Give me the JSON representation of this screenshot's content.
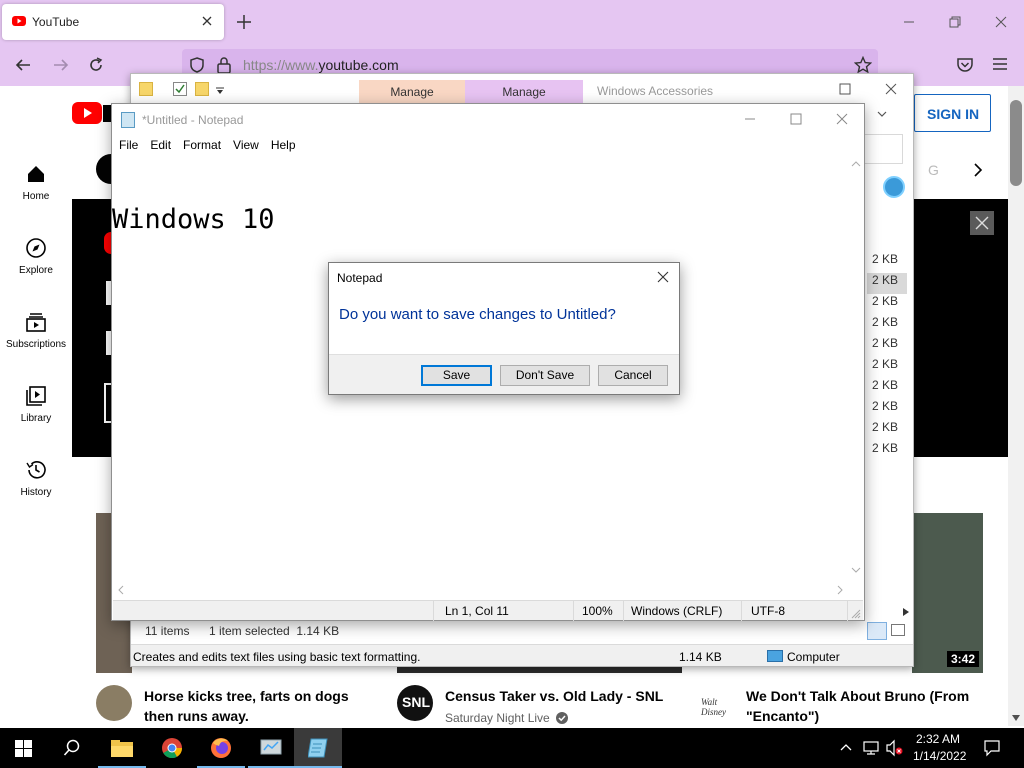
{
  "browser": {
    "tab_title": "YouTube",
    "url_dim": "https://www.",
    "url_host": "youtube.com",
    "accent": "#e5c6f2"
  },
  "youtube": {
    "sign_in": "SIGN IN",
    "nav": [
      {
        "label": "Home",
        "icon": "home-icon"
      },
      {
        "label": "Explore",
        "icon": "compass-icon"
      },
      {
        "label": "Subscriptions",
        "icon": "subscriptions-icon"
      },
      {
        "label": "Library",
        "icon": "library-icon"
      },
      {
        "label": "History",
        "icon": "history-icon"
      }
    ],
    "chip_next_letter": "G",
    "duration": "3:42",
    "videos": [
      {
        "title": "Horse kicks tree, farts on dogs then runs away.",
        "channel": ""
      },
      {
        "title": "Census Taker vs. Old Lady - SNL",
        "channel": "Saturday Night Live"
      },
      {
        "title": "We Don't Talk About Bruno (From \"Encanto\")",
        "channel": ""
      }
    ]
  },
  "explorer": {
    "tabs": [
      "Manage",
      "Manage"
    ],
    "title": "Windows Accessories",
    "sizes": [
      "2 KB",
      "2 KB",
      "2 KB",
      "2 KB",
      "2 KB",
      "2 KB",
      "2 KB",
      "2 KB",
      "2 KB",
      "2 KB"
    ],
    "items_count": "11 items",
    "selected": "1 item selected  1.14 KB",
    "status_desc": "Creates and edits text files using basic text formatting.",
    "status_size": "1.14 KB",
    "status_location": "Computer"
  },
  "notepad": {
    "title": "*Untitled - Notepad",
    "menu": [
      "File",
      "Edit",
      "Format",
      "View",
      "Help"
    ],
    "content": "Windows 10",
    "status": {
      "position": "Ln 1, Col 11",
      "zoom": "100%",
      "line_ending": "Windows (CRLF)",
      "encoding": "UTF-8"
    }
  },
  "dialog": {
    "title": "Notepad",
    "message": "Do you want to save changes to Untitled?",
    "save": "Save",
    "dont_save": "Don't Save",
    "cancel": "Cancel",
    "message_color": "#003399"
  },
  "taskbar": {
    "time": "2:32 AM",
    "date": "1/14/2022"
  }
}
